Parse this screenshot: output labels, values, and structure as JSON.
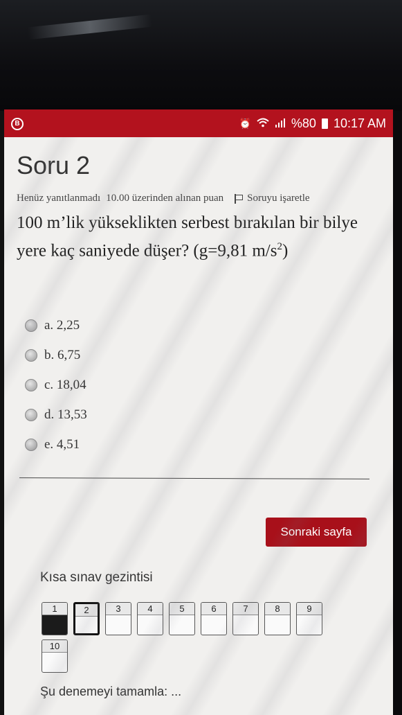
{
  "status_bar": {
    "bixby_glyph": "B",
    "icons": [
      "alarm-icon",
      "wifi-icon",
      "signal-icon"
    ],
    "battery": "%80",
    "time": "10:17 AM",
    "bar_color": "#b3121e"
  },
  "question": {
    "title": "Soru 2",
    "state": "Henüz yanıtlanmadı",
    "points": "10.00 üzerinden alınan puan",
    "flag_label": "Soruyu işaretle",
    "text": "100 m’lik yükseklikten serbest bırakılan bir bilye yere kaç saniyede düşer? (g=9,81 m/s",
    "text_sup": "2",
    "text_end": ")",
    "answers": [
      {
        "label": "a. 2,25"
      },
      {
        "label": "b. 6,75"
      },
      {
        "label": "c. 18,04"
      },
      {
        "label": "d. 13,53"
      },
      {
        "label": "e. 4,51"
      }
    ]
  },
  "next_button": {
    "label": "Sonraki sayfa",
    "color": "#a8101a"
  },
  "quiz_nav": {
    "title": "Kısa sınav gezintisi",
    "buttons": [
      {
        "num": "1",
        "state": "answered"
      },
      {
        "num": "2",
        "state": "current"
      },
      {
        "num": "3",
        "state": "unanswered"
      },
      {
        "num": "4",
        "state": "unanswered"
      },
      {
        "num": "5",
        "state": "unanswered"
      },
      {
        "num": "6",
        "state": "unanswered"
      },
      {
        "num": "7",
        "state": "unanswered"
      },
      {
        "num": "8",
        "state": "unanswered"
      },
      {
        "num": "9",
        "state": "unanswered"
      },
      {
        "num": "10",
        "state": "unanswered"
      }
    ]
  },
  "finish_link": "Şu denemeyi tamamla: ..."
}
